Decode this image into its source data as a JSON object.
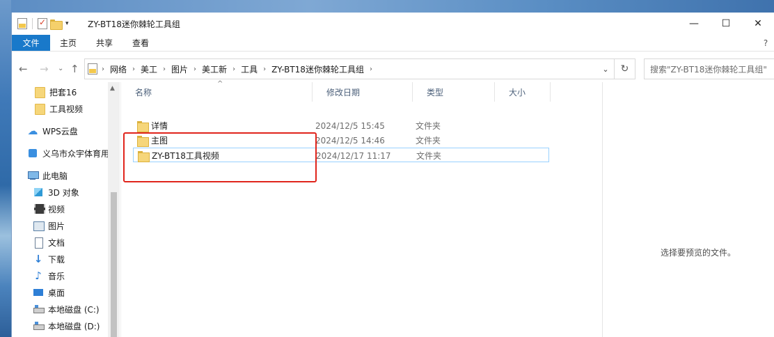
{
  "window": {
    "title": "ZY-BT18迷你棘轮工具组",
    "controls": {
      "minimize": "—",
      "maximize": "☐",
      "close": "✕"
    }
  },
  "ribbon": {
    "tabs": [
      "文件",
      "主页",
      "共享",
      "查看"
    ],
    "help_glyph": "?"
  },
  "nav": {
    "back": "←",
    "forward": "→",
    "recent": "⌄",
    "up": "↑",
    "breadcrumb": [
      "网络",
      "美工",
      "图片",
      "美工新",
      "工具",
      "ZY-BT18迷你棘轮工具组"
    ],
    "refresh": "↻",
    "search_placeholder": "搜索\"ZY-BT18迷你棘轮工具组\""
  },
  "sidebar": {
    "items": [
      {
        "label": "把套16",
        "icon": "folder-icon"
      },
      {
        "label": "工具视频",
        "icon": "folder-icon"
      },
      {
        "label": "WPS云盘",
        "icon": "cloud-icon"
      },
      {
        "label": "义乌市众宇体育用",
        "icon": "person-icon"
      },
      {
        "label": "此电脑",
        "icon": "pc-icon"
      },
      {
        "label": "3D 对象",
        "icon": "3d-objects-icon"
      },
      {
        "label": "视频",
        "icon": "video-icon"
      },
      {
        "label": "图片",
        "icon": "pictures-icon"
      },
      {
        "label": "文档",
        "icon": "documents-icon"
      },
      {
        "label": "下载",
        "icon": "downloads-icon"
      },
      {
        "label": "音乐",
        "icon": "music-icon"
      },
      {
        "label": "桌面",
        "icon": "desktop-icon"
      },
      {
        "label": "本地磁盘 (C:)",
        "icon": "drive-icon"
      },
      {
        "label": "本地磁盘 (D:)",
        "icon": "drive-icon"
      }
    ]
  },
  "columns": {
    "name": "名称",
    "date": "修改日期",
    "type": "类型",
    "size": "大小"
  },
  "files": [
    {
      "name": "详情",
      "date": "2024/12/5 15:45",
      "type": "文件夹"
    },
    {
      "name": "主图",
      "date": "2024/12/5 14:46",
      "type": "文件夹"
    },
    {
      "name": "ZY-BT18工具视频",
      "date": "2024/12/17 11:17",
      "type": "文件夹"
    }
  ],
  "preview": {
    "message": "选择要预览的文件。"
  }
}
